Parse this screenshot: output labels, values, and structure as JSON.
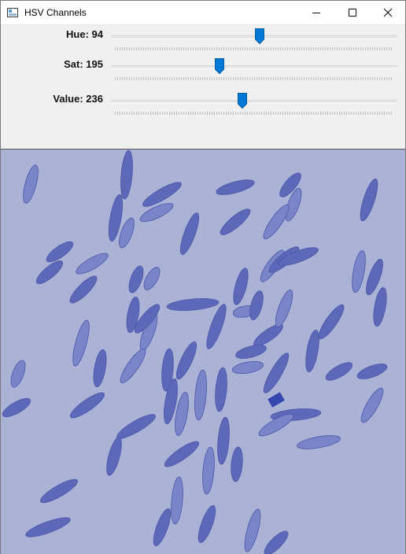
{
  "window": {
    "title": "HSV Channels"
  },
  "controls": {
    "hue": {
      "label": "Hue: 94",
      "fraction": 0.52
    },
    "sat": {
      "label": "Sat: 195",
      "fraction": 0.38
    },
    "value": {
      "label": "Value: 236",
      "fraction": 0.46
    }
  },
  "colors": {
    "thumb": "#0078d7",
    "background": "#aab3d6",
    "grain": "#5d68b8",
    "grain_light": "#7a84c8"
  },
  "icons": [
    "window-app-icon",
    "minimize-icon",
    "maximize-icon",
    "close-icon"
  ]
}
